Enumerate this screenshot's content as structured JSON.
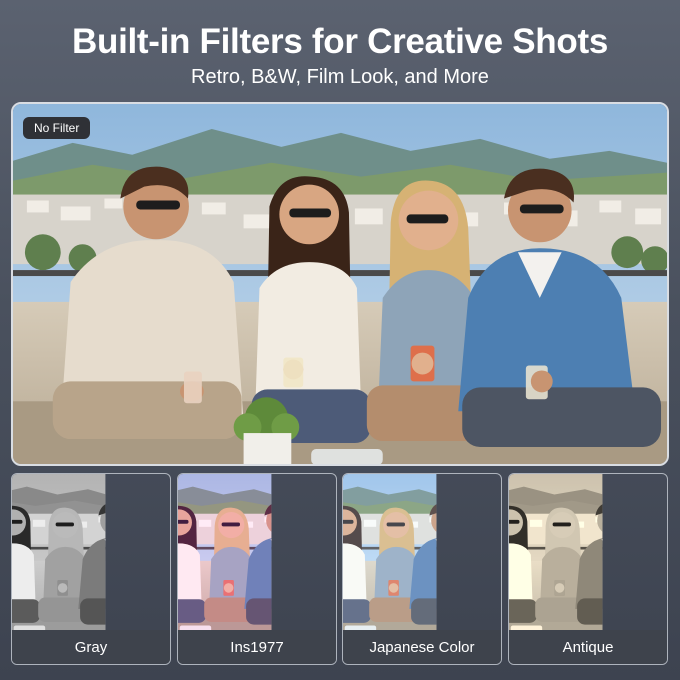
{
  "header": {
    "title": "Built-in Filters for Creative Shots",
    "subtitle": "Retro, B&W, Film Look, and More"
  },
  "main_photo": {
    "badge": "No Filter",
    "scene": "four-friends-laughing-on-rooftop-sofa"
  },
  "filters": [
    {
      "label": "Gray"
    },
    {
      "label": "Ins1977"
    },
    {
      "label": "Japanese Color"
    },
    {
      "label": "Antique"
    }
  ],
  "colors": {
    "background": "#4a515e",
    "label_bar": "#3e434c",
    "badge_bg": "#2f3136",
    "text": "#ffffff"
  }
}
